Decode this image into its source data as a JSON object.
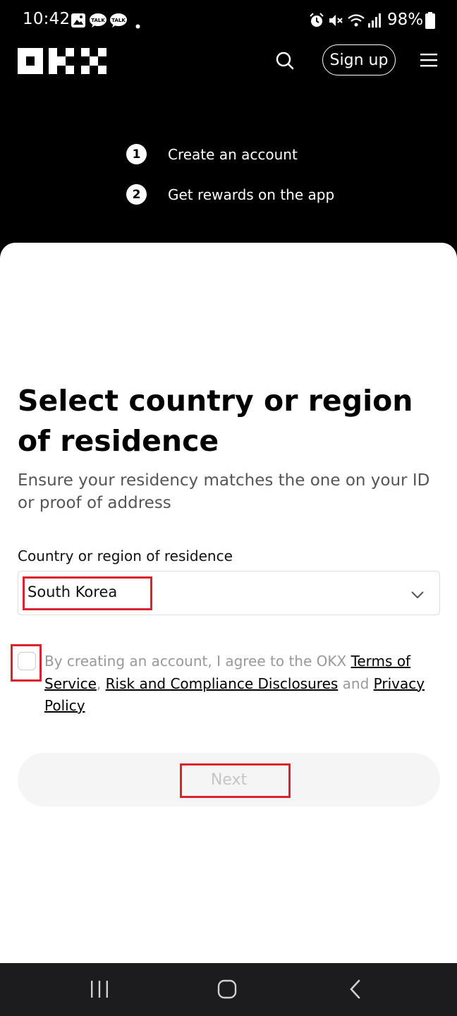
{
  "status_bar": {
    "time": "10:42",
    "left_icons": [
      "gallery-icon",
      "kakaotalk-icon",
      "kakaotalk-icon",
      "dot-icon"
    ],
    "right_icons": [
      "alarm-icon",
      "mute-icon",
      "wifi-icon",
      "signal-icon",
      "battery-icon"
    ],
    "battery": "98%",
    "badge_text": "TALK"
  },
  "header": {
    "logo_text": "OKX",
    "signup_label": "Sign up"
  },
  "steps": [
    {
      "num": "1",
      "text": "Create an account"
    },
    {
      "num": "2",
      "text": "Get rewards on the app"
    }
  ],
  "form": {
    "title": "Select country or region of residence",
    "subtitle": "Ensure your residency matches the one on your ID or proof of address",
    "country_label": "Country or region of residence",
    "country_value": "South Korea",
    "terms": {
      "prefix": "By creating an account, I agree to the OKX ",
      "tos": "Terms of Service",
      "sep": ", ",
      "risk": "Risk and Compliance Disclosures",
      "and": " and ",
      "privacy": "Privacy Policy"
    },
    "next_label": "Next"
  },
  "colors": {
    "highlight": "#d9232e",
    "background": "#000000",
    "card": "#ffffff"
  }
}
